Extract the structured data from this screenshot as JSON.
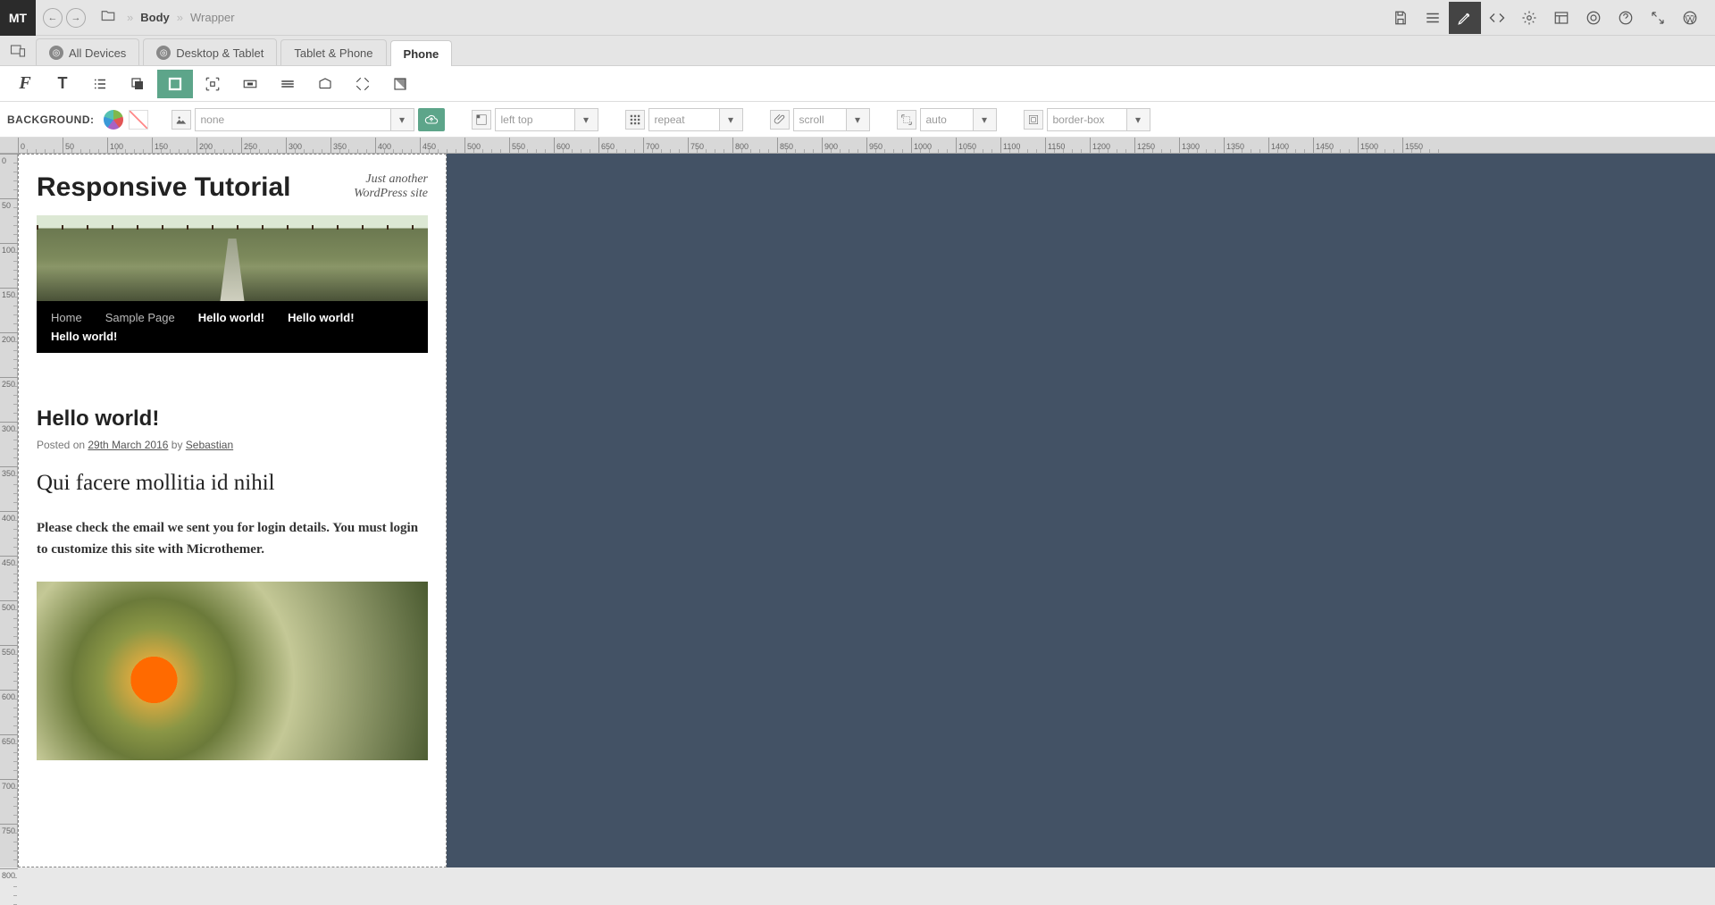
{
  "logo": "MT",
  "breadcrumb": {
    "item1": "Body",
    "item2": "Wrapper"
  },
  "topRight": {
    "save": "save-icon",
    "align": "align-icon",
    "edit": "edit-icon",
    "code": "code-icon",
    "settings": "gear-icon",
    "screen": "screen-icon",
    "support": "lifesaver-icon",
    "help": "help-icon",
    "expand": "expand-icon",
    "wp": "wordpress-icon"
  },
  "respTabs": {
    "t1": "All Devices",
    "t2": "Desktop & Tablet",
    "t3": "Tablet & Phone",
    "t4": "Phone"
  },
  "bgBar": {
    "label": "BACKGROUND:",
    "imagePlaceholder": "none",
    "posPlaceholder": "left top",
    "repeatPlaceholder": "repeat",
    "attachPlaceholder": "scroll",
    "sizePlaceholder": "auto",
    "clipPlaceholder": "border-box"
  },
  "preview": {
    "siteTitle": "Responsive Tutorial",
    "tagline": "Just another WordPress site",
    "nav": {
      "n1": "Home",
      "n2": "Sample Page",
      "n3": "Hello world!",
      "n4": "Hello world!",
      "n5": "Hello world!"
    },
    "postTitle": "Hello world!",
    "postedOn": "Posted on ",
    "postDate": "29th March 2016",
    "by": " by ",
    "author": "Sebastian",
    "subheading": "Qui facere mollitia id nihil",
    "body": "Please check the email we sent you for login details. You must login to customize this site with Microthemer."
  }
}
